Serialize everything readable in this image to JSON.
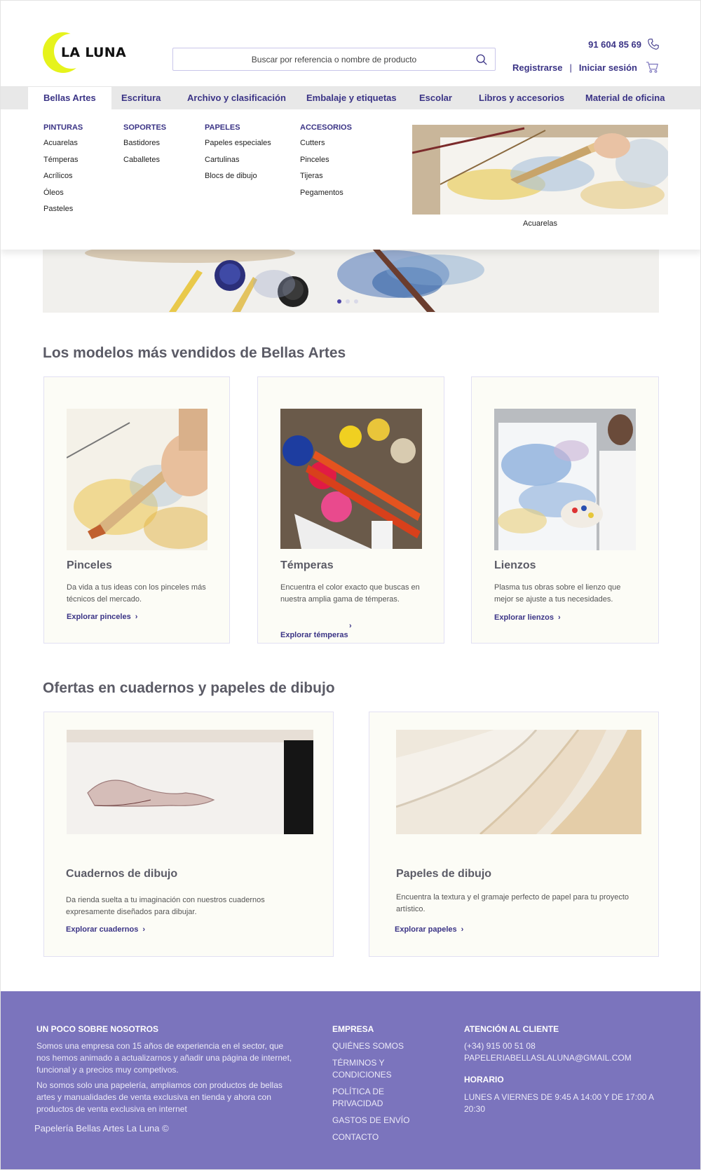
{
  "brand": {
    "name": "LA LUNA",
    "accent": "#3b3486",
    "moon_color": "#e6f31c"
  },
  "header": {
    "search_placeholder": "Buscar por referencia o nombre de producto",
    "phone": "91 604 85 69",
    "register": "Registrarse",
    "separator": "|",
    "login": "Iniciar sesión",
    "icons": [
      "search-icon",
      "phone-icon",
      "cart-icon"
    ]
  },
  "nav": {
    "items": [
      "Bellas Artes",
      "Escritura",
      "Archivo y clasificación",
      "Embalaje y etiquetas",
      "Escolar",
      "Libros y accesorios",
      "Material de oficina"
    ],
    "active": "Bellas Artes"
  },
  "mega": {
    "columns": [
      {
        "title": "PINTURAS",
        "items": [
          "Acuarelas",
          "Témperas",
          "Acrílicos",
          "Óleos",
          "Pasteles"
        ]
      },
      {
        "title": "SOPORTES",
        "items": [
          "Bastidores",
          "Caballetes"
        ]
      },
      {
        "title": "PAPELES",
        "items": [
          "Papeles especiales",
          "Cartulinas",
          "Blocs de dibujo"
        ]
      },
      {
        "title": "ACCESORIOS",
        "items": [
          "Cutters",
          "Pinceles",
          "Tijeras",
          "Pegamentos"
        ]
      }
    ],
    "feature_caption": "Acuarelas"
  },
  "hero": {
    "slides": 3,
    "active_slide": 1
  },
  "bestsellers": {
    "title": "Los modelos más vendidos de Bellas Artes",
    "cards": [
      {
        "title": "Pinceles",
        "desc": "Da vida a tus ideas con los pinceles más técnicos del mercado.",
        "link": "Explorar pinceles"
      },
      {
        "title": "Témperas",
        "desc": "Encuentra el color exacto que buscas en nuestra amplia gama de témperas.",
        "link": "Explorar témperas"
      },
      {
        "title": "Lienzos",
        "desc": "Plasma tus obras sobre el lienzo que mejor se ajuste a tus necesidades.",
        "link": "Explorar lienzos"
      }
    ]
  },
  "offers": {
    "title": "Ofertas en cuadernos y papeles de dibujo",
    "cards": [
      {
        "title": "Cuadernos de dibujo",
        "desc": "Da rienda suelta a tu imaginación con nuestros cuadernos expresamente diseñados para dibujar.",
        "link": "Explorar cuadernos"
      },
      {
        "title": "Papeles de dibujo",
        "desc": "Encuentra la textura y el gramaje perfecto de papel para tu proyecto artístico.",
        "link": "Explorar papeles"
      }
    ]
  },
  "footer": {
    "about_title": "UN POCO SOBRE NOSOTROS",
    "about_p1": "Somos una empresa con 15 años de experiencia en el sector, que nos hemos animado a actualizarnos y añadir una página de internet, funcional y a precios muy competivos.",
    "about_p2": "No somos solo una papelería, ampliamos con productos de bellas artes y manualidades de venta exclusiva en tienda y ahora con productos de venta exclusiva en internet",
    "copyright": "Papelería Bellas Artes La Luna  ©",
    "company_title": "EMPRESA",
    "company_links": [
      "QUIÉNES SOMOS",
      "TÉRMINOS Y CONDICIONES",
      "POLÍTICA DE PRIVACIDAD",
      "GASTOS DE ENVÍO",
      "CONTACTO"
    ],
    "support_title": "ATENCIÓN AL CLIENTE",
    "support_phone": "(+34) 915 00 51 08",
    "support_email": "PAPELERIABELLASLALUNA@GMAIL.COM",
    "hours_title": "HORARIO",
    "hours": "LUNES A VIERNES DE 9:45 A 14:00 Y DE 17:00 A 20:30"
  }
}
